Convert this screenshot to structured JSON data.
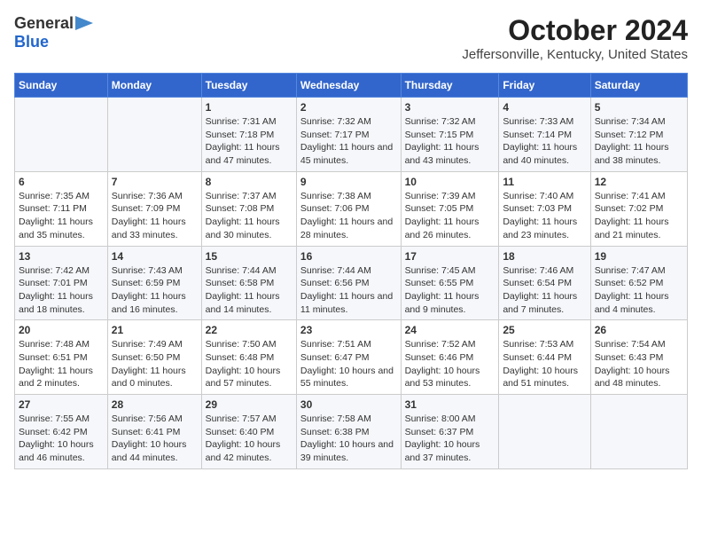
{
  "logo": {
    "line1": "General",
    "line2": "Blue"
  },
  "title": "October 2024",
  "subtitle": "Jeffersonville, Kentucky, United States",
  "days_of_week": [
    "Sunday",
    "Monday",
    "Tuesday",
    "Wednesday",
    "Thursday",
    "Friday",
    "Saturday"
  ],
  "weeks": [
    [
      {
        "day": "",
        "sunrise": "",
        "sunset": "",
        "daylight": ""
      },
      {
        "day": "",
        "sunrise": "",
        "sunset": "",
        "daylight": ""
      },
      {
        "day": "1",
        "sunrise": "Sunrise: 7:31 AM",
        "sunset": "Sunset: 7:18 PM",
        "daylight": "Daylight: 11 hours and 47 minutes."
      },
      {
        "day": "2",
        "sunrise": "Sunrise: 7:32 AM",
        "sunset": "Sunset: 7:17 PM",
        "daylight": "Daylight: 11 hours and 45 minutes."
      },
      {
        "day": "3",
        "sunrise": "Sunrise: 7:32 AM",
        "sunset": "Sunset: 7:15 PM",
        "daylight": "Daylight: 11 hours and 43 minutes."
      },
      {
        "day": "4",
        "sunrise": "Sunrise: 7:33 AM",
        "sunset": "Sunset: 7:14 PM",
        "daylight": "Daylight: 11 hours and 40 minutes."
      },
      {
        "day": "5",
        "sunrise": "Sunrise: 7:34 AM",
        "sunset": "Sunset: 7:12 PM",
        "daylight": "Daylight: 11 hours and 38 minutes."
      }
    ],
    [
      {
        "day": "6",
        "sunrise": "Sunrise: 7:35 AM",
        "sunset": "Sunset: 7:11 PM",
        "daylight": "Daylight: 11 hours and 35 minutes."
      },
      {
        "day": "7",
        "sunrise": "Sunrise: 7:36 AM",
        "sunset": "Sunset: 7:09 PM",
        "daylight": "Daylight: 11 hours and 33 minutes."
      },
      {
        "day": "8",
        "sunrise": "Sunrise: 7:37 AM",
        "sunset": "Sunset: 7:08 PM",
        "daylight": "Daylight: 11 hours and 30 minutes."
      },
      {
        "day": "9",
        "sunrise": "Sunrise: 7:38 AM",
        "sunset": "Sunset: 7:06 PM",
        "daylight": "Daylight: 11 hours and 28 minutes."
      },
      {
        "day": "10",
        "sunrise": "Sunrise: 7:39 AM",
        "sunset": "Sunset: 7:05 PM",
        "daylight": "Daylight: 11 hours and 26 minutes."
      },
      {
        "day": "11",
        "sunrise": "Sunrise: 7:40 AM",
        "sunset": "Sunset: 7:03 PM",
        "daylight": "Daylight: 11 hours and 23 minutes."
      },
      {
        "day": "12",
        "sunrise": "Sunrise: 7:41 AM",
        "sunset": "Sunset: 7:02 PM",
        "daylight": "Daylight: 11 hours and 21 minutes."
      }
    ],
    [
      {
        "day": "13",
        "sunrise": "Sunrise: 7:42 AM",
        "sunset": "Sunset: 7:01 PM",
        "daylight": "Daylight: 11 hours and 18 minutes."
      },
      {
        "day": "14",
        "sunrise": "Sunrise: 7:43 AM",
        "sunset": "Sunset: 6:59 PM",
        "daylight": "Daylight: 11 hours and 16 minutes."
      },
      {
        "day": "15",
        "sunrise": "Sunrise: 7:44 AM",
        "sunset": "Sunset: 6:58 PM",
        "daylight": "Daylight: 11 hours and 14 minutes."
      },
      {
        "day": "16",
        "sunrise": "Sunrise: 7:44 AM",
        "sunset": "Sunset: 6:56 PM",
        "daylight": "Daylight: 11 hours and 11 minutes."
      },
      {
        "day": "17",
        "sunrise": "Sunrise: 7:45 AM",
        "sunset": "Sunset: 6:55 PM",
        "daylight": "Daylight: 11 hours and 9 minutes."
      },
      {
        "day": "18",
        "sunrise": "Sunrise: 7:46 AM",
        "sunset": "Sunset: 6:54 PM",
        "daylight": "Daylight: 11 hours and 7 minutes."
      },
      {
        "day": "19",
        "sunrise": "Sunrise: 7:47 AM",
        "sunset": "Sunset: 6:52 PM",
        "daylight": "Daylight: 11 hours and 4 minutes."
      }
    ],
    [
      {
        "day": "20",
        "sunrise": "Sunrise: 7:48 AM",
        "sunset": "Sunset: 6:51 PM",
        "daylight": "Daylight: 11 hours and 2 minutes."
      },
      {
        "day": "21",
        "sunrise": "Sunrise: 7:49 AM",
        "sunset": "Sunset: 6:50 PM",
        "daylight": "Daylight: 11 hours and 0 minutes."
      },
      {
        "day": "22",
        "sunrise": "Sunrise: 7:50 AM",
        "sunset": "Sunset: 6:48 PM",
        "daylight": "Daylight: 10 hours and 57 minutes."
      },
      {
        "day": "23",
        "sunrise": "Sunrise: 7:51 AM",
        "sunset": "Sunset: 6:47 PM",
        "daylight": "Daylight: 10 hours and 55 minutes."
      },
      {
        "day": "24",
        "sunrise": "Sunrise: 7:52 AM",
        "sunset": "Sunset: 6:46 PM",
        "daylight": "Daylight: 10 hours and 53 minutes."
      },
      {
        "day": "25",
        "sunrise": "Sunrise: 7:53 AM",
        "sunset": "Sunset: 6:44 PM",
        "daylight": "Daylight: 10 hours and 51 minutes."
      },
      {
        "day": "26",
        "sunrise": "Sunrise: 7:54 AM",
        "sunset": "Sunset: 6:43 PM",
        "daylight": "Daylight: 10 hours and 48 minutes."
      }
    ],
    [
      {
        "day": "27",
        "sunrise": "Sunrise: 7:55 AM",
        "sunset": "Sunset: 6:42 PM",
        "daylight": "Daylight: 10 hours and 46 minutes."
      },
      {
        "day": "28",
        "sunrise": "Sunrise: 7:56 AM",
        "sunset": "Sunset: 6:41 PM",
        "daylight": "Daylight: 10 hours and 44 minutes."
      },
      {
        "day": "29",
        "sunrise": "Sunrise: 7:57 AM",
        "sunset": "Sunset: 6:40 PM",
        "daylight": "Daylight: 10 hours and 42 minutes."
      },
      {
        "day": "30",
        "sunrise": "Sunrise: 7:58 AM",
        "sunset": "Sunset: 6:38 PM",
        "daylight": "Daylight: 10 hours and 39 minutes."
      },
      {
        "day": "31",
        "sunrise": "Sunrise: 8:00 AM",
        "sunset": "Sunset: 6:37 PM",
        "daylight": "Daylight: 10 hours and 37 minutes."
      },
      {
        "day": "",
        "sunrise": "",
        "sunset": "",
        "daylight": ""
      },
      {
        "day": "",
        "sunrise": "",
        "sunset": "",
        "daylight": ""
      }
    ]
  ]
}
